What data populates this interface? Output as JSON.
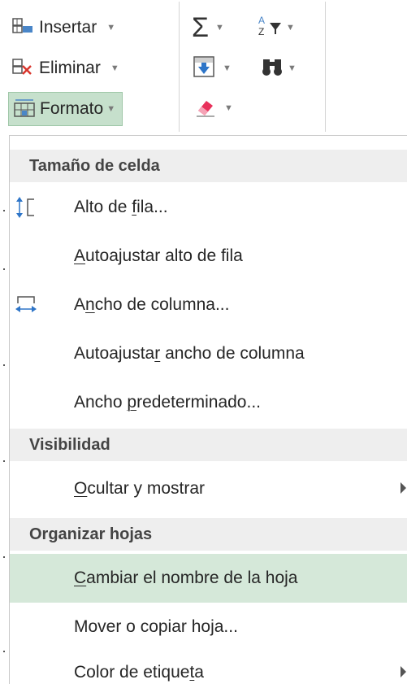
{
  "ribbon": {
    "insertar": "Insertar",
    "eliminar": "Eliminar",
    "formato": "Formato",
    "autosum_icon": "autosum-sigma-icon",
    "sort_icon": "sort-filter-icon",
    "fill_icon": "fill-down-icon",
    "find_icon": "find-binoculars-icon",
    "clear_icon": "clear-eraser-icon"
  },
  "menu": {
    "sections": [
      {
        "header": "Tamaño de celda",
        "items": [
          {
            "pre": "Alto de ",
            "key": "f",
            "post": "ila...",
            "icon": "row-height-icon"
          },
          {
            "pre": "",
            "key": "A",
            "post": "utoajustar alto de fila"
          },
          {
            "pre": "A",
            "key": "n",
            "post": "cho de columna...",
            "icon": "column-width-icon"
          },
          {
            "pre": "Autoajusta",
            "key": "r",
            "post": " ancho de columna"
          },
          {
            "pre": "Ancho ",
            "key": "p",
            "post": "redeterminado..."
          }
        ]
      },
      {
        "header": "Visibilidad",
        "items": [
          {
            "pre": "",
            "key": "O",
            "post": "cultar y mostrar",
            "submenu": true
          }
        ]
      },
      {
        "header": "Organizar hojas",
        "items": [
          {
            "pre": "",
            "key": "C",
            "post": "ambiar el nombre de la hoja",
            "highlighted": true
          },
          {
            "pre": "",
            "key": "",
            "post": "Mover o copiar hoja..."
          },
          {
            "pre": "Color de etique",
            "key": "t",
            "post": "a",
            "submenu": true
          }
        ]
      }
    ]
  }
}
